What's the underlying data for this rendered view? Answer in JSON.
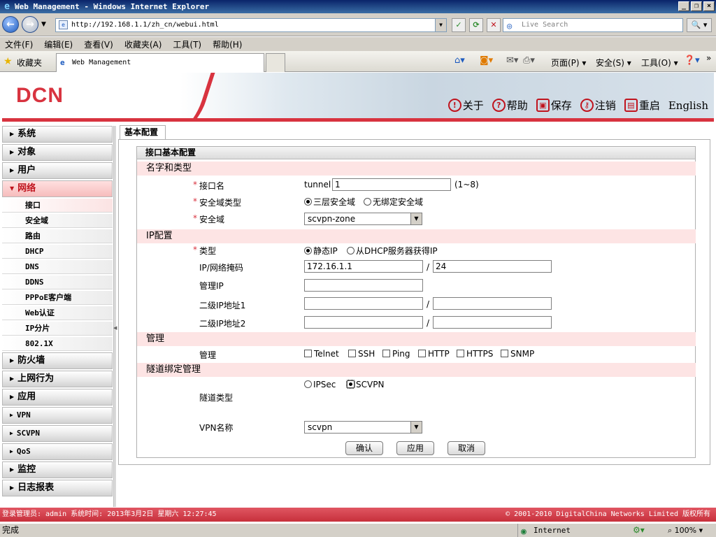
{
  "browser": {
    "window_title": "Web Management - Windows Internet Explorer",
    "address": "http://192.168.1.1/zh_cn/webui.html",
    "search_placeholder": "Live Search",
    "menu": [
      "文件(F)",
      "编辑(E)",
      "查看(V)",
      "收藏夹(A)",
      "工具(T)",
      "帮助(H)"
    ],
    "favorites_label": "收藏夹",
    "tab_title": "Web Management",
    "commands": {
      "page": "页面(P)",
      "safety": "安全(S)",
      "tools": "工具(O)"
    },
    "status_text": "完成",
    "zone": "Internet",
    "zoom": "100%"
  },
  "header": {
    "logo": "DCN",
    "links": {
      "about": "关于",
      "help": "帮助",
      "save": "保存",
      "logout": "注销",
      "reboot": "重启",
      "english": "English"
    }
  },
  "sidebar": {
    "items": [
      {
        "label": "系统"
      },
      {
        "label": "对象"
      },
      {
        "label": "用户"
      },
      {
        "label": "网络"
      }
    ],
    "sub_items": [
      "接口",
      "安全域",
      "路由",
      "DHCP",
      "DNS",
      "DDNS",
      "PPPoE客户端",
      "Web认证",
      "IP分片",
      "802.1X"
    ],
    "items_after": [
      {
        "label": "防火墙"
      },
      {
        "label": "上网行为"
      },
      {
        "label": "应用"
      },
      {
        "label": "VPN"
      },
      {
        "label": "SCVPN"
      },
      {
        "label": "QoS"
      },
      {
        "label": "监控"
      },
      {
        "label": "日志报表"
      }
    ]
  },
  "content": {
    "tab": "基本配置",
    "panel_title": "接口基本配置",
    "sections": {
      "name_type": "名字和类型",
      "ip": "IP配置",
      "manage": "管理",
      "tunnel": "隧道绑定管理"
    },
    "fields": {
      "interface_name_label": "接口名",
      "interface_prefix": "tunnel",
      "interface_value": "1",
      "interface_hint": "(1~8)",
      "zone_type_label": "安全域类型",
      "zone_type_l3": "三层安全域",
      "zone_type_none": "无绑定安全域",
      "zone_label": "安全域",
      "zone_value": "scvpn-zone",
      "ip_type_label": "类型",
      "ip_static": "静态IP",
      "ip_dhcp": "从DHCP服务器获得IP",
      "ip_mask_label": "IP/网络掩码",
      "ip_value": "172.16.1.1",
      "mask_value": "24",
      "mgmt_ip_label": "管理IP",
      "secondary1_label": "二级IP地址1",
      "secondary2_label": "二级IP地址2",
      "slash": "/",
      "manage_label": "管理",
      "manage_options": [
        "Telnet",
        "SSH",
        "Ping",
        "HTTP",
        "HTTPS",
        "SNMP"
      ],
      "tunnel_type_label": "隧道类型",
      "tunnel_ipsec": "IPSec",
      "tunnel_scvpn": "SCVPN",
      "vpn_name_label": "VPN名称",
      "vpn_name_value": "scvpn"
    },
    "buttons": {
      "ok": "确认",
      "apply": "应用",
      "cancel": "取消"
    }
  },
  "footer": {
    "left": "登录管理员: admin 系统时间: 2013年3月2日 星期六 12:27:45",
    "right": "© 2001-2010 DigitalChina Networks Limited 版权所有"
  },
  "colors": {
    "brand": "#d8333f",
    "section_bg": "#fde4e4"
  }
}
